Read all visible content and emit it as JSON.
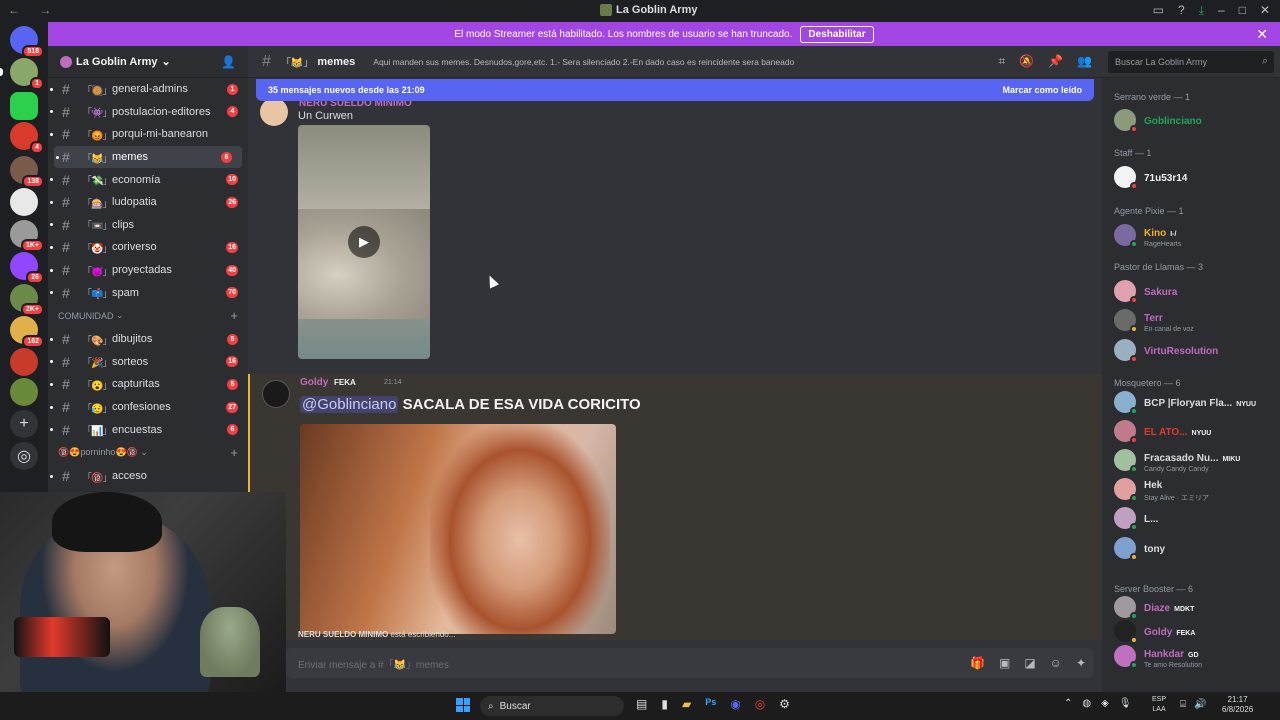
{
  "window": {
    "title": "La Goblin Army",
    "nav": "← →"
  },
  "banner": {
    "text": "El modo Streamer está habilitado. Los nombres de usuario se han truncado.",
    "button": "Deshabilitar",
    "color": "#a246e3"
  },
  "server_rail": {
    "badges": [
      "518",
      "1",
      "4",
      "138",
      "1K+",
      "26",
      "2K+",
      "162"
    ]
  },
  "sidebar": {
    "server_name": "La Goblin Army",
    "channels": [
      {
        "emoji": "「🥘」",
        "name": "general-admins",
        "count": "1"
      },
      {
        "emoji": "「👾」",
        "name": "postulacion-editores",
        "count": "4"
      },
      {
        "emoji": "「😡」",
        "name": "porqui-mi-banearon",
        "count": ""
      },
      {
        "emoji": "「😹」",
        "name": "memes",
        "count": "6"
      },
      {
        "emoji": "「💸」",
        "name": "economía",
        "count": "10"
      },
      {
        "emoji": "「🎰」",
        "name": "ludopatia",
        "count": "26"
      },
      {
        "emoji": "「📼」",
        "name": "clips",
        "count": ""
      },
      {
        "emoji": "「🤡」",
        "name": "coriverso",
        "count": "16"
      },
      {
        "emoji": "「😈」",
        "name": "proyectadas",
        "count": "40"
      },
      {
        "emoji": "「📫」",
        "name": "spam",
        "count": "70"
      }
    ],
    "category_comunidad": "COMUNIDAD",
    "channels2": [
      {
        "emoji": "「🎨」",
        "name": "dibujitos",
        "count": "5"
      },
      {
        "emoji": "「🎉」",
        "name": "sorteos",
        "count": "16"
      },
      {
        "emoji": "「😮」",
        "name": "capturitas",
        "count": "5"
      },
      {
        "emoji": "「😥」",
        "name": "confesiones",
        "count": "27"
      },
      {
        "emoji": "「📊」",
        "name": "encuestas",
        "count": "6"
      }
    ],
    "category_porninho": "🔞😍porninho😍🔞",
    "channels3": [
      {
        "emoji": "「🔞」",
        "name": "acceso",
        "count": ""
      }
    ]
  },
  "chat_header": {
    "emoji": "「😹」",
    "channel": "memes",
    "topic": "Aqui manden sus memes. Desnudos,gore,etc. 1.- Sera silenciado 2.-En dado caso es reincidente sera baneado",
    "search_placeholder": "Buscar La Goblin Army"
  },
  "chat": {
    "new_messages": "35 mensajes nuevos desde las 21:09",
    "mark_read": "Marcar como leído",
    "old_author": "NERU SUELDO MINIMO",
    "old_text": "Un Curwen",
    "goldy_name": "Goldy",
    "goldy_tag": "FEKA",
    "goldy_time": "21:14",
    "mention": "@Goblinciano",
    "goldy_text": "SACALA DE ESA VIDA CORICITO",
    "typing_user": "NERU SUELDO MINIMO",
    "typing_suffix": "está escribiendo...",
    "composer_placeholder": "Enviar mensaje a #「😹」memes"
  },
  "members": {
    "groups": [
      {
        "label": "Serrano verde — 1"
      },
      {
        "label": "Staff — 1"
      },
      {
        "label": "Agente Pixie — 1"
      },
      {
        "label": "Pastor de Llamas — 3"
      },
      {
        "label": "Mosquetero — 6"
      },
      {
        "label": "Server Booster — 6"
      }
    ],
    "list": [
      {
        "name": "Goblinciano",
        "sub": "",
        "tag": "",
        "color": "#23a55a"
      },
      {
        "name": "71u53r14",
        "sub": "",
        "tag": "",
        "color": "#f2f3f5"
      },
      {
        "name": "Kino",
        "sub": "RageHearts",
        "tag": "I-/",
        "color": "#f0b232"
      },
      {
        "name": "Sakura",
        "sub": "",
        "tag": "",
        "color": "#c06bc0"
      },
      {
        "name": "Terr",
        "sub": "En canal de voz",
        "tag": "",
        "color": "#c06bc0"
      },
      {
        "name": "VirtuResolution",
        "sub": "",
        "tag": "",
        "color": "#c06bc0"
      },
      {
        "name": "BCP |Floryan Fla...",
        "sub": "",
        "tag": "NYUU",
        "color": "#dbdee1"
      },
      {
        "name": "EL ATO...",
        "sub": "",
        "tag": "NYUU",
        "color": "#e23a2c"
      },
      {
        "name": "Fracasado Nu...",
        "sub": "Candy Candy Candy",
        "tag": "MIKU",
        "color": "#dbdee1"
      },
      {
        "name": "Hek",
        "sub": "Stay Alive · エミリア",
        "tag": "",
        "color": "#dbdee1"
      },
      {
        "name": "L...",
        "sub": "",
        "tag": "",
        "color": "#dbdee1"
      },
      {
        "name": "tony",
        "sub": "",
        "tag": "",
        "color": "#dbdee1"
      },
      {
        "name": "Diaze",
        "sub": "",
        "tag": "MDKT",
        "color": "#c06bc0"
      },
      {
        "name": "Goldy",
        "sub": "",
        "tag": "FEKA",
        "color": "#c06bc0"
      },
      {
        "name": "Hankdar",
        "sub": "Te amo Resolution",
        "tag": "GD",
        "color": "#c06bc0"
      }
    ]
  },
  "taskbar": {
    "search": "Buscar",
    "lang1": "ESP",
    "lang2": "LAA",
    "time": "21:17",
    "date": "6/8/2026"
  }
}
